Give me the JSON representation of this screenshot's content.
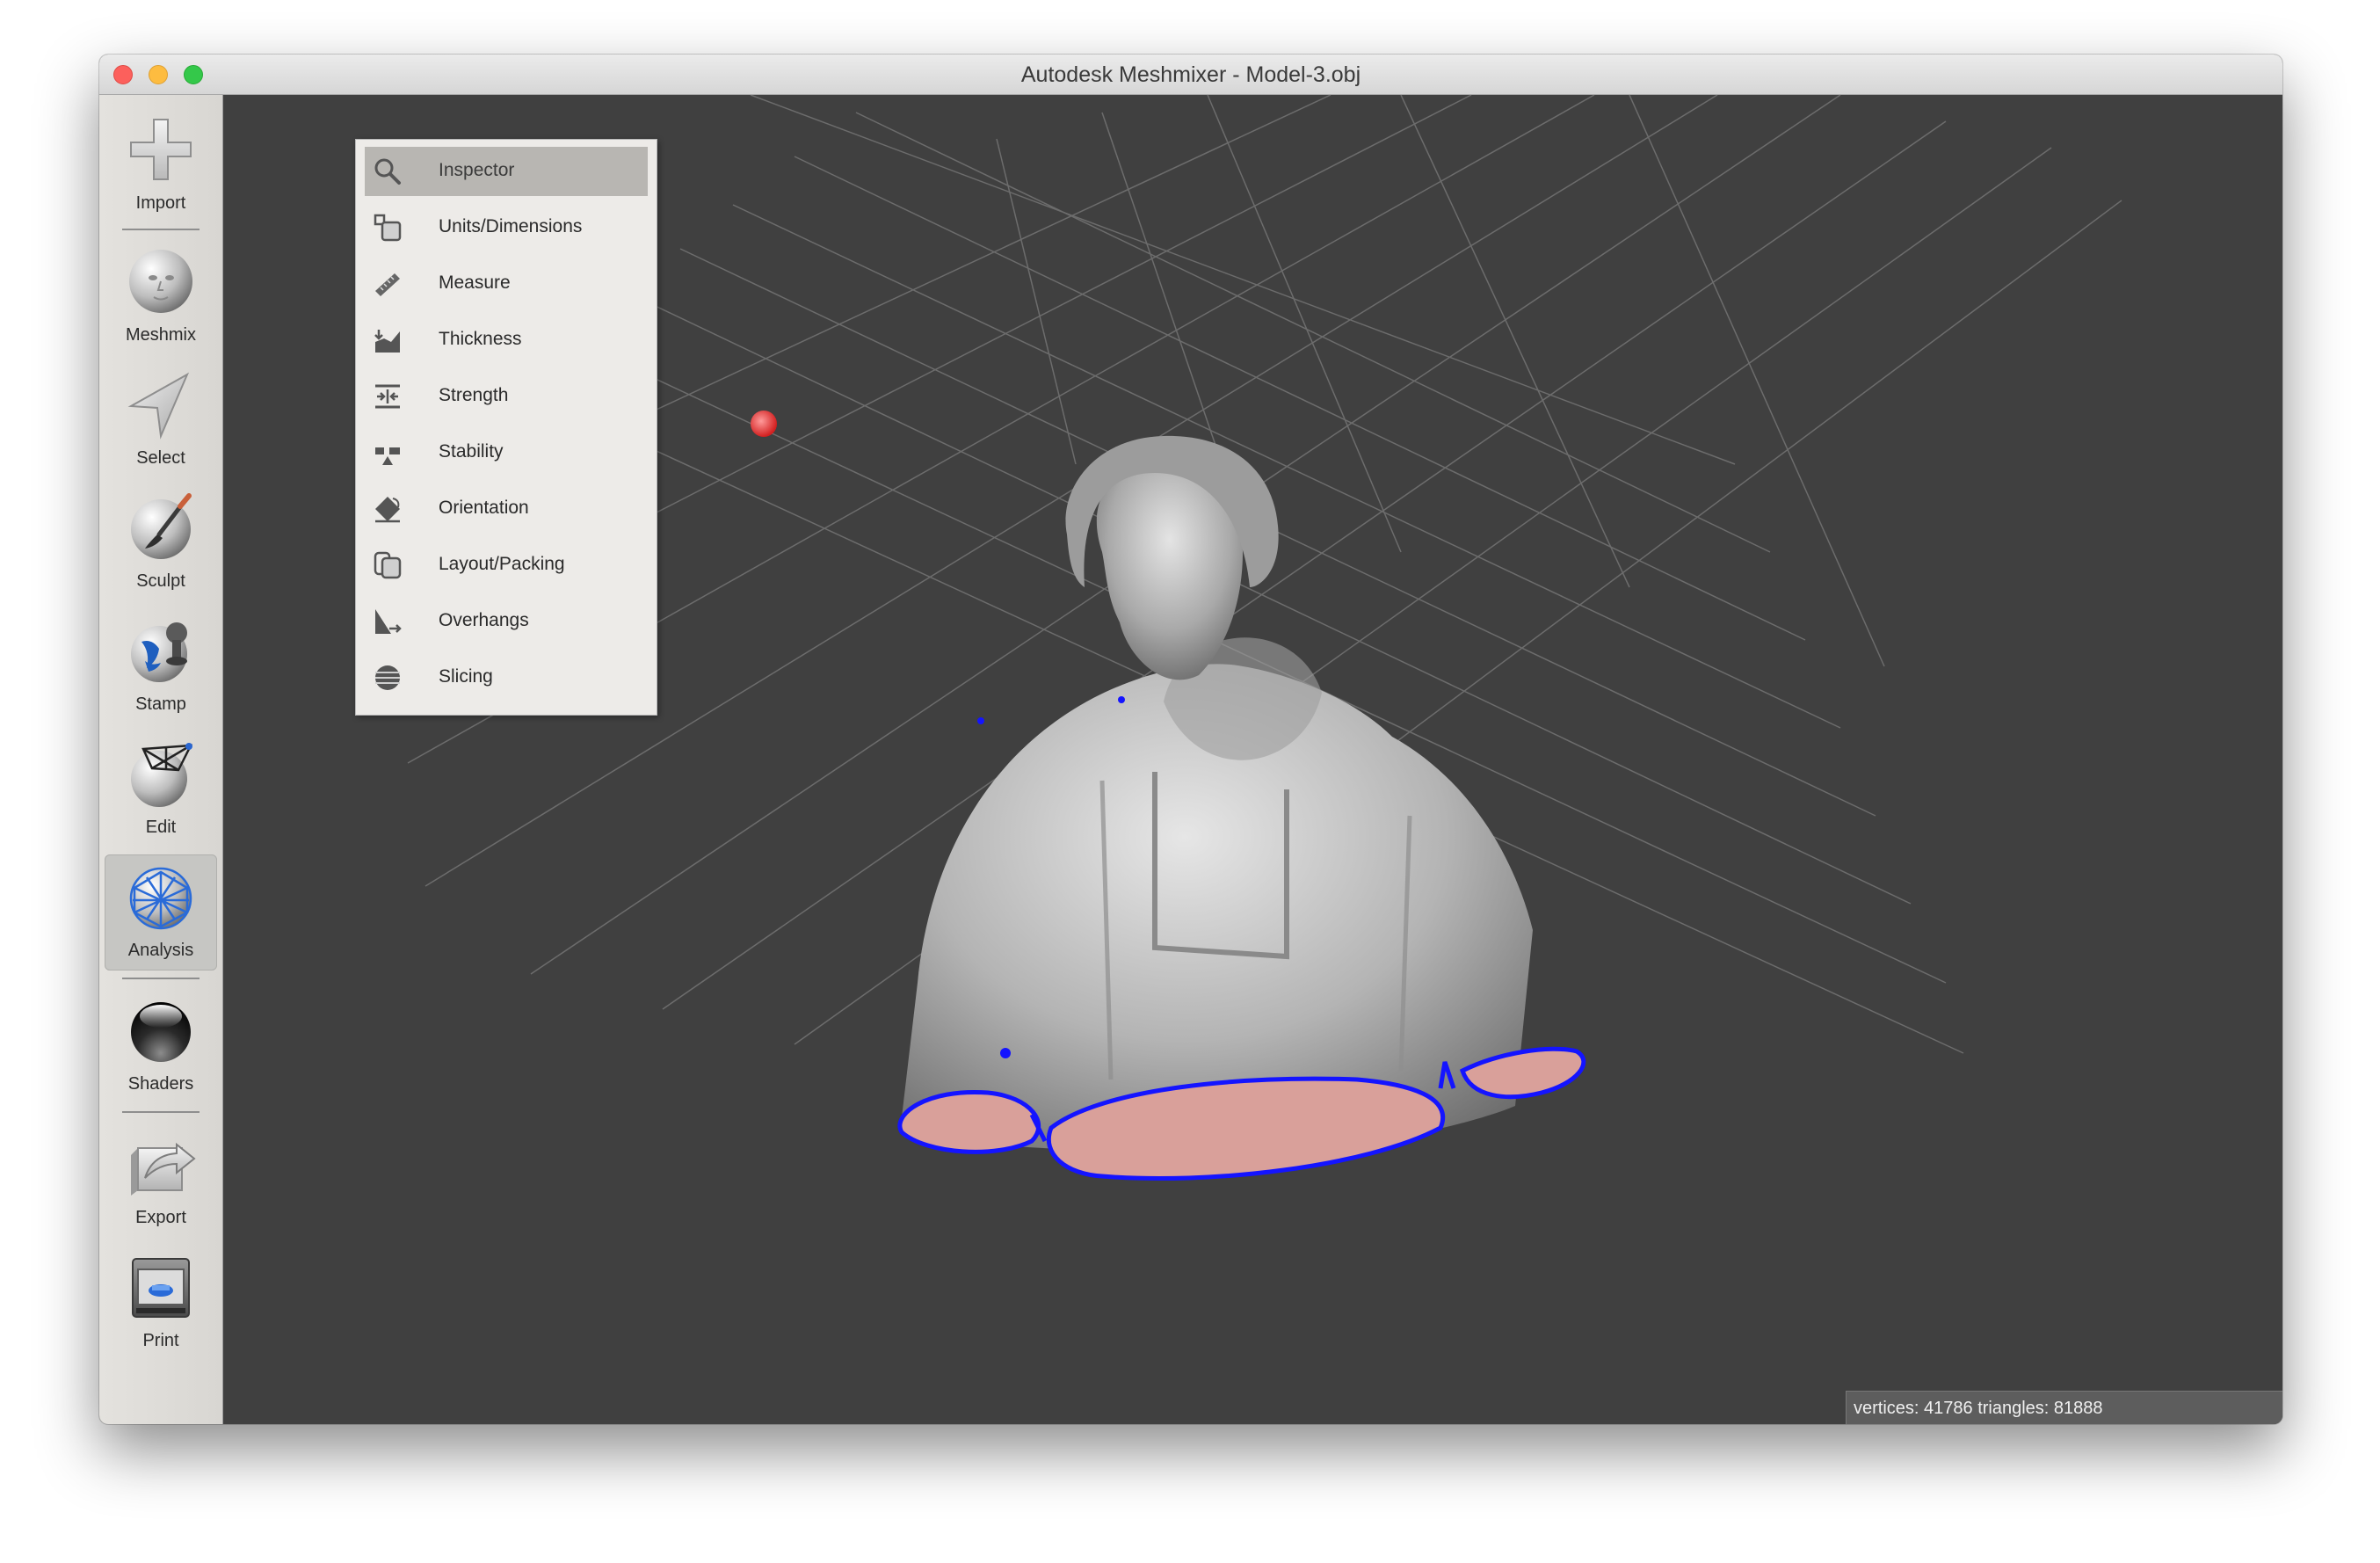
{
  "window": {
    "title": "Autodesk Meshmixer - Model-3.obj"
  },
  "toolbar": {
    "items": [
      {
        "label": "Import",
        "icon": "plus-icon"
      },
      {
        "label": "Meshmix",
        "icon": "face-sphere-icon"
      },
      {
        "label": "Select",
        "icon": "arrow-cursor-icon"
      },
      {
        "label": "Sculpt",
        "icon": "brush-sphere-icon"
      },
      {
        "label": "Stamp",
        "icon": "stamp-sphere-icon"
      },
      {
        "label": "Edit",
        "icon": "edit-sphere-icon"
      },
      {
        "label": "Analysis",
        "icon": "mesh-sphere-icon",
        "active": true
      },
      {
        "label": "Shaders",
        "icon": "glossy-sphere-icon"
      },
      {
        "label": "Export",
        "icon": "export-icon"
      },
      {
        "label": "Print",
        "icon": "printer-icon"
      }
    ]
  },
  "analysis_menu": {
    "items": [
      {
        "label": "Inspector",
        "icon": "magnifier-icon",
        "selected": true
      },
      {
        "label": "Units/Dimensions",
        "icon": "units-icon"
      },
      {
        "label": "Measure",
        "icon": "ruler-icon"
      },
      {
        "label": "Thickness",
        "icon": "thickness-icon"
      },
      {
        "label": "Strength",
        "icon": "strength-icon"
      },
      {
        "label": "Stability",
        "icon": "stability-icon"
      },
      {
        "label": "Orientation",
        "icon": "orientation-icon"
      },
      {
        "label": "Layout/Packing",
        "icon": "layout-icon"
      },
      {
        "label": "Overhangs",
        "icon": "overhang-icon"
      },
      {
        "label": "Slicing",
        "icon": "slicing-icon"
      }
    ]
  },
  "status": {
    "text": "vertices: 41786 triangles: 81888"
  },
  "colors": {
    "viewport_bg": "#404040",
    "boundary": "#1414ff",
    "cut_face": "#d9a09a",
    "pivot": "#e23a3a"
  }
}
